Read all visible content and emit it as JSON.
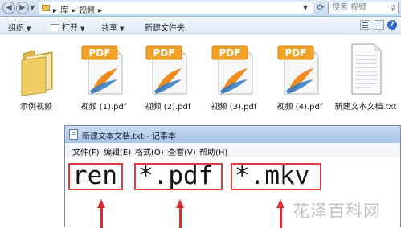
{
  "explorer": {
    "address_path": [
      "库",
      "视频"
    ],
    "search_placeholder": "搜索 视频",
    "toolbar": {
      "organize": "组织",
      "open": "打开",
      "share": "共享",
      "new_folder": "新建文件夹"
    },
    "files": [
      {
        "name": "示例视频",
        "icon": "folder-icon"
      },
      {
        "name": "视频 (1).pdf",
        "icon": "pdf-icon"
      },
      {
        "name": "视频 (2).pdf",
        "icon": "pdf-icon"
      },
      {
        "name": "视频 (3).pdf",
        "icon": "pdf-icon"
      },
      {
        "name": "视频 (4).pdf",
        "icon": "pdf-icon"
      },
      {
        "name": "新建文本文档.txt",
        "icon": "txt-icon"
      }
    ],
    "pdf_badge": "PDF"
  },
  "notepad": {
    "title": "新建文本文档.txt - 记事本",
    "menu": [
      "文件(F)",
      "编辑(E)",
      "格式(O)",
      "查看(V)",
      "帮助(H)"
    ],
    "content_tokens": [
      "ren",
      "*.pdf",
      "*.mkv"
    ],
    "highlight_color": "#e33b43"
  },
  "watermark": "花泽百科网"
}
